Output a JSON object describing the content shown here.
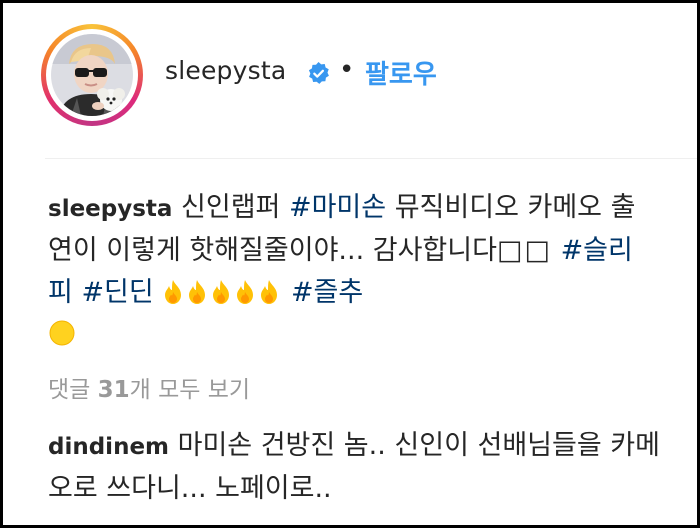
{
  "post": {
    "username": "sleepysta",
    "separator": "•",
    "follow_label": "팔로우"
  },
  "caption": {
    "username": "sleepysta",
    "text_1": " 신인랩퍼 ",
    "tag_1": "#마미손",
    "text_2": " 뮤직비디오 카메오 출연이 이렇게 핫해질줄이야... 감사합니다",
    "boxes": "□□",
    "tag_2": "#슬리피",
    "tag_3": "#딘딘",
    "tag_4": "#즐추",
    "emoji_fire_count": 5,
    "emoji_sun": "sun-emoji"
  },
  "comments": {
    "view_all_prefix": "댓글 ",
    "count": "31",
    "view_all_suffix": "개 모두 보기"
  },
  "comment": {
    "username": "dindinem",
    "text": " 마미손 건방진 놈.. 신인이 선배님들을 카메오로 쓰다니... 노페이로.."
  },
  "colors": {
    "link_blue": "#3897f0",
    "hashtag": "#003569",
    "muted": "#999999",
    "text": "#262626"
  }
}
